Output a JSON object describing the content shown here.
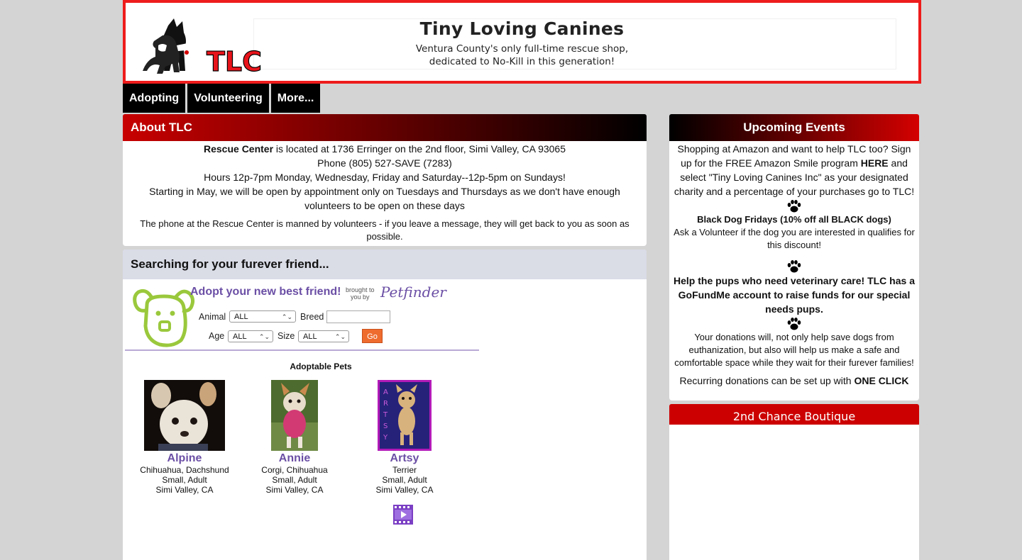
{
  "header": {
    "title": "Tiny Loving Canines",
    "subtitle_line1": "Ventura County's only full-time rescue shop,",
    "subtitle_line2": "dedicated to No-Kill in this generation!",
    "logo_text": "TLC"
  },
  "nav": {
    "items": [
      "Adopting",
      "Volunteering",
      "More..."
    ]
  },
  "about": {
    "heading": "About TLC",
    "line1_bold": "Rescue Center",
    "line1_rest": " is located at 1736 Erringer on the 2nd floor, Simi Valley, CA 93065",
    "phone": "Phone (805) 527-SAVE (7283)",
    "hours": "Hours 12p-7pm Monday, Wednesday, Friday and Saturday--12p-5pm on Sundays!",
    "may_notice": "Starting in May, we will be open by appointment only on Tuesdays and Thursdays as we don't have enough volunteers to be open on these days",
    "phone_note": "The phone at the Rescue Center is manned by volunteers - if you leave a message, they will get back to you as soon as possible."
  },
  "search": {
    "heading": "Searching for your furever friend...",
    "widget": {
      "title": "Adopt your new best friend!",
      "brought_by": "brought to\nyou by",
      "brand": "Petfinder",
      "animal_label": "Animal",
      "animal_value": "ALL",
      "breed_label": "Breed",
      "breed_value": "",
      "age_label": "Age",
      "age_value": "ALL",
      "size_label": "Size",
      "size_value": "ALL",
      "go_label": "Go",
      "adoptable_heading": "Adoptable Pets"
    },
    "pets": [
      {
        "name": "Alpine",
        "breed": "Chihuahua, Dachshund",
        "size_age": "Small, Adult",
        "location": "Simi Valley, CA"
      },
      {
        "name": "Annie",
        "breed": "Corgi, Chihuahua",
        "size_age": "Small, Adult",
        "location": "Simi Valley, CA"
      },
      {
        "name": "Artsy",
        "breed": "Terrier",
        "size_age": "Small, Adult",
        "location": "Simi Valley, CA"
      }
    ]
  },
  "events": {
    "heading": "Upcoming Events",
    "amazon_1": "Shopping at Amazon and want to help TLC too? Sign up for the FREE Amazon Smile program ",
    "amazon_here": "HERE",
    "amazon_2": " and select \"Tiny Loving Canines Inc\" as your designated charity and a percentage of your purchases go to TLC!",
    "black_dog": "Black Dog Fridays (10% off all BLACK dogs)",
    "black_dog_note": "Ask a Volunteer if the dog you are interested in qualifies for this discount!",
    "gofundme": "Help the pups who need veterinary care! TLC has a GoFundMe account to raise funds for our special needs pups.",
    "donations": "Your donations will, not only help save dogs from euthanization, but also will help us make a safe and comfortable space while they wait for their furever families!",
    "recurring_1": "Recurring donations can be set up with ",
    "recurring_bold": "ONE CLICK"
  },
  "boutique": {
    "heading": "2nd Chance Boutique"
  },
  "colors": {
    "header_border": "#ee1c1c",
    "brand_red": "#cc0000",
    "petfinder_purple": "#6b4fa5",
    "go_orange": "#ee6c2e",
    "page_bg": "#d4d4d4"
  }
}
